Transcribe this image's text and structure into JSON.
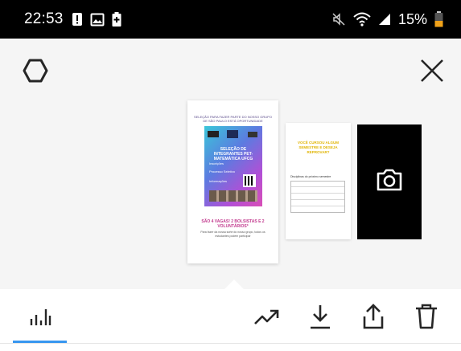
{
  "status_bar": {
    "time": "22:53",
    "battery_percent": "15%",
    "left_icons": [
      "notification-alert-icon",
      "image-icon",
      "battery-saver-icon"
    ],
    "right_icons": [
      "mute-icon",
      "wifi-icon",
      "signal-icon",
      "battery-low-icon"
    ]
  },
  "top_bar": {
    "settings_icon": "gear-icon",
    "close_icon": "close-icon"
  },
  "stories": {
    "main": {
      "header": "SELEÇÃO PARA FAZER PARTE DO NOSSO GRUPO DE SÃO PAULO ESTÁ OPORTUNIDADE",
      "poster_title": "SELEÇÃO DE INTEGRANTES PET-MATEMÁTICA UFCG",
      "poster_sub1": "Inscrições",
      "poster_sub2": "Processo Seletivo",
      "poster_sub3": "Informações",
      "vagas": "SÃO 4 VAGAS! 2 BOLSISTAS E 2 VOLUNTÁRIOS*",
      "footer": "Para fazer da nossa sorte do nosso grupo, todos os estudantes podem participar"
    },
    "second": {
      "title": "VOCÊ CURSOU ALGUM SEMESTRE E DESEJA REPROVAR?",
      "table_label": "Disciplinas do próximo semestre"
    },
    "camera_icon": "camera-icon"
  },
  "toolbar": {
    "accent_color": "#3897f0",
    "items": [
      {
        "icon": "insights-bars-icon",
        "active": true
      },
      {
        "icon": "trending-icon"
      },
      {
        "icon": "download-icon"
      },
      {
        "icon": "share-icon"
      },
      {
        "icon": "trash-icon"
      }
    ]
  }
}
